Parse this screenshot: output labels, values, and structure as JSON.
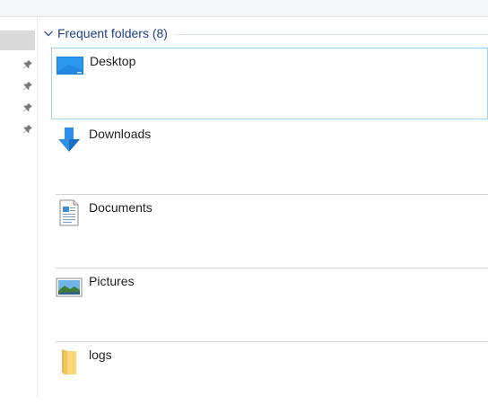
{
  "group": {
    "title": "Frequent folders (8)"
  },
  "folders": [
    {
      "name": "Desktop",
      "icon": "desktop-icon"
    },
    {
      "name": "Downloads",
      "icon": "downloads-icon"
    },
    {
      "name": "Documents",
      "icon": "documents-icon"
    },
    {
      "name": "Pictures",
      "icon": "pictures-icon"
    },
    {
      "name": "logs",
      "icon": "folder-icon"
    }
  ],
  "colors": {
    "header_text": "#1e3d8f",
    "selection_border": "#99d1ff",
    "folder_yellow": "#f8d775",
    "download_blue": "#2e8ee8"
  }
}
